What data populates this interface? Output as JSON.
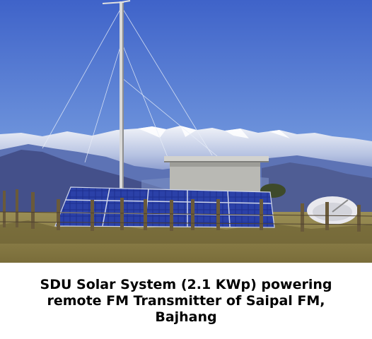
{
  "photo": {
    "alt": "",
    "colors": {
      "sky_top": "#3f63c9",
      "sky_bottom": "#b9d1ef",
      "mountain_snow": "#eef1f7",
      "mountain_blue": "#5d73b5",
      "hill_dark": "#44508a",
      "ground": "#8e8348",
      "panel": "#1e2f8f",
      "shed": "#b9b9b4",
      "mast": "#d9d9d9"
    },
    "icons": [
      "antenna-mast",
      "solar-panels",
      "equipment-shed",
      "satellite-dish",
      "wooden-fence"
    ]
  },
  "caption": {
    "text": "SDU Solar System (2.1 KWp) powering remote FM Transmitter of Saipal FM, Bajhang"
  }
}
